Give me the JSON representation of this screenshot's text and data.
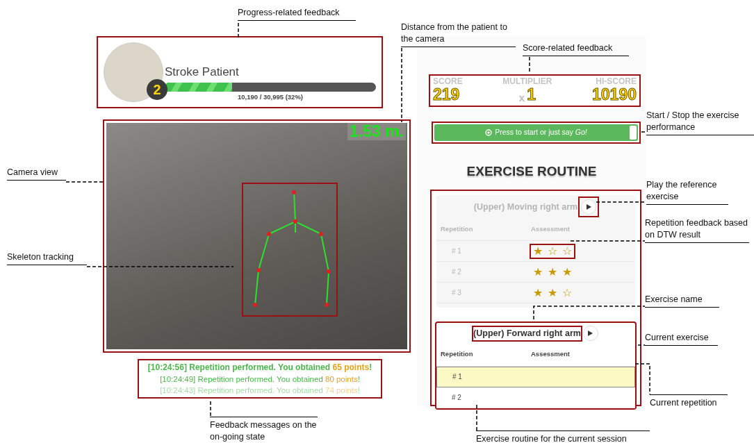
{
  "profile": {
    "name": "Stroke Patient",
    "level_badge": "2",
    "progress": {
      "level": 0.32,
      "reading": "10,190 / 30,995 (32%)"
    }
  },
  "camera": {
    "distance": "1.53 m."
  },
  "messages": [
    {
      "kind": "latest",
      "text": "[10:24:56] Repetition performed. You obtained ",
      "points": "65 points",
      "end": "!"
    },
    {
      "kind": "recent",
      "text": "[10:24:49] Repetition performed. You obtained ",
      "points": "80 points",
      "end": "!"
    },
    {
      "kind": "old",
      "text": "[10:24:43] Repetition performed. You obtained ",
      "points": "74 points",
      "end": "!"
    }
  ],
  "scores": [
    {
      "label": "SCORE",
      "value": "219"
    },
    {
      "label": "MULTIPLIER",
      "prefix": "x",
      "value": "1"
    },
    {
      "label": "HI-SCORE",
      "value": "10190"
    }
  ],
  "start_button": {
    "text": "Press to start or just say *Go!*"
  },
  "routine": {
    "title": "EXERCISE ROUTINE",
    "exercises": [
      {
        "name": "(Upper) Moving right arm",
        "active": false,
        "name_highlighted": false,
        "play_highlighted": true,
        "columns": [
          "Repetition",
          "Assessment"
        ],
        "rows": [
          {
            "label": "# 1",
            "stars": 1,
            "highlighted": true
          },
          {
            "label": "# 2",
            "stars": 3,
            "highlighted": false
          },
          {
            "label": "# 3",
            "stars": 2,
            "highlighted": false
          }
        ]
      },
      {
        "name": "(Upper) Forward right arm",
        "active": true,
        "name_highlighted": true,
        "play_highlighted": false,
        "columns": [
          "Repetition",
          "Assessment"
        ],
        "rows": [
          {
            "label": "# 1",
            "selected": true
          },
          {
            "label": "# 2",
            "selected": false
          }
        ]
      }
    ]
  },
  "annotations": [
    {
      "text": "Progress-related feedback",
      "kind": "rule-below"
    },
    {
      "text": "Distance from the patient to the camera",
      "kind": "rule-below"
    },
    {
      "text": "Score-related feedback",
      "kind": "rule-below"
    },
    {
      "text": "Start / Stop the exercise performance",
      "kind": "rule-below"
    },
    {
      "text": "Camera view",
      "kind": "rule-below"
    },
    {
      "text": "Skeleton tracking",
      "kind": "rule-below"
    },
    {
      "text": "Play the reference exercise",
      "kind": "rule-below"
    },
    {
      "text": "Repetition feedback based on DTW result",
      "kind": "rule-below"
    },
    {
      "text": "Exercise name",
      "kind": "rule-below"
    },
    {
      "text": "Current exercise",
      "kind": "rule-below"
    },
    {
      "text": "Current repetition",
      "kind": "rule-above"
    },
    {
      "text": "Feedback messages on the on-going state",
      "kind": "rule-above"
    },
    {
      "text": "Exercise routine for the current session",
      "kind": "rule-above"
    }
  ]
}
